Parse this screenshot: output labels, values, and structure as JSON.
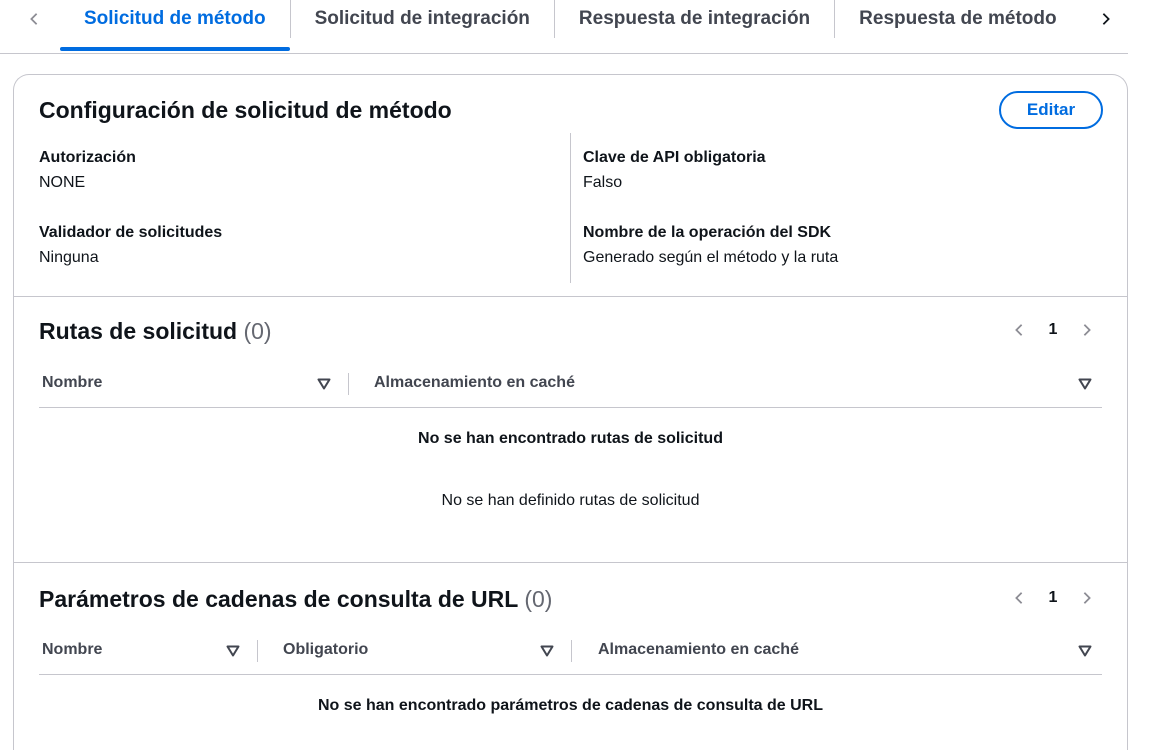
{
  "tabs": [
    {
      "label": "Solicitud de método",
      "active": true
    },
    {
      "label": "Solicitud de integración",
      "active": false
    },
    {
      "label": "Respuesta de integración",
      "active": false
    },
    {
      "label": "Respuesta de método",
      "active": false
    }
  ],
  "config": {
    "title": "Configuración de solicitud de método",
    "edit_label": "Editar",
    "fields": {
      "authorization": {
        "label": "Autorización",
        "value": "NONE"
      },
      "api_key": {
        "label": "Clave de API obligatoria",
        "value": "Falso"
      },
      "validator": {
        "label": "Validador de solicitudes",
        "value": "Ninguna"
      },
      "sdk_operation": {
        "label": "Nombre de la operación del SDK",
        "value": "Generado según el método y la ruta"
      }
    }
  },
  "request_paths": {
    "title": "Rutas de solicitud",
    "count": "(0)",
    "page": "1",
    "columns": [
      "Nombre",
      "Almacenamiento en caché"
    ],
    "empty_title": "No se han encontrado rutas de solicitud",
    "empty_desc": "No se han definido rutas de solicitud"
  },
  "query_params": {
    "title": "Parámetros de cadenas de consulta de URL",
    "count": "(0)",
    "page": "1",
    "columns": [
      "Nombre",
      "Obligatorio",
      "Almacenamiento en caché"
    ],
    "empty_title": "No se han encontrado parámetros de cadenas de consulta de URL"
  },
  "colors": {
    "accent": "#006ce0",
    "border": "#c6c6cd",
    "text": "#0f141a",
    "muted": "#656871"
  }
}
